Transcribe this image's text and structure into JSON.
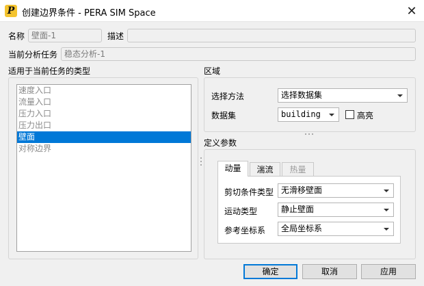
{
  "window": {
    "title": "创建边界条件 - PERA SIM Space",
    "close_glyph": "✕",
    "app_icon_letter": "P"
  },
  "form": {
    "name_label": "名称",
    "name_value": "壁面-1",
    "desc_label": "描述",
    "desc_value": "",
    "task_label": "当前分析任务",
    "task_value": "稳态分析-1"
  },
  "types": {
    "heading": "适用于当前任务的类型",
    "items": [
      {
        "label": "速度入口",
        "selected": false
      },
      {
        "label": "流量入口",
        "selected": false
      },
      {
        "label": "压力入口",
        "selected": false
      },
      {
        "label": "压力出口",
        "selected": false
      },
      {
        "label": "壁面",
        "selected": true
      },
      {
        "label": "对称边界",
        "selected": false
      }
    ]
  },
  "region": {
    "heading": "区域",
    "method_label": "选择方法",
    "method_value": "选择数据集",
    "dataset_label": "数据集",
    "dataset_value": "building",
    "highlight_label": "高亮",
    "highlight_checked": false
  },
  "params": {
    "heading": "定义参数",
    "tabs": [
      {
        "label": "动量",
        "state": "active"
      },
      {
        "label": "湍流",
        "state": "normal"
      },
      {
        "label": "热量",
        "state": "disabled"
      }
    ],
    "shear_label": "剪切条件类型",
    "shear_value": "无滑移壁面",
    "motion_label": "运动类型",
    "motion_value": "静止壁面",
    "coord_label": "参考坐标系",
    "coord_value": "全局坐标系"
  },
  "buttons": {
    "ok": "确定",
    "cancel": "取消",
    "apply": "应用"
  },
  "colors": {
    "selection": "#0078d7",
    "app_icon": "#f4c430"
  },
  "icons": {
    "app": "pera-logo-icon",
    "close": "close-icon",
    "dropdown": "chevron-down-icon"
  }
}
